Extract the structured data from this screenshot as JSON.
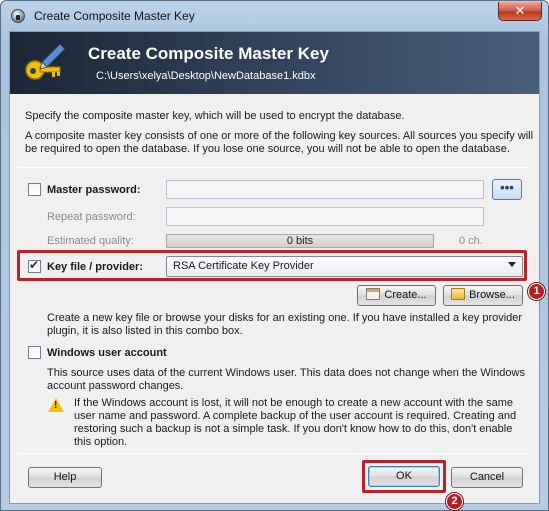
{
  "window": {
    "title": "Create Composite Master Key",
    "close_label": "✕"
  },
  "banner": {
    "title": "Create Composite Master Key",
    "path": "C:\\Users\\xelya\\Desktop\\NewDatabase1.kdbx"
  },
  "intro": {
    "line1": "Specify the composite master key, which will be used to encrypt the database.",
    "line2": "A composite master key consists of one or more of the following key sources. All sources you specify will",
    "line3": "be required to open the database.  If you lose one source, you will not be able to open the database."
  },
  "password": {
    "label": "Master password:",
    "checked": false,
    "repeat_label": "Repeat password:",
    "quality_label": "Estimated quality:",
    "quality_value": "0 bits",
    "quality_chars": "0 ch.",
    "reveal_label": "•••"
  },
  "keyfile": {
    "label": "Key file / provider:",
    "checked": true,
    "selected": "RSA Certificate Key Provider",
    "create_label": "Create...",
    "browse_label": "Browse...",
    "help_line1": "Create a new key file or browse your disks for an existing one. If you have installed a key provider",
    "help_line2": "plugin, it is also listed in this combo box."
  },
  "winuser": {
    "label": "Windows user account",
    "checked": false,
    "desc1": "This source uses data of the current Windows user. This data does not change when the Windows",
    "desc2": "account password changes.",
    "warn1": "If the Windows account is lost, it will not be enough to create a new account with the same",
    "warn2": "user name and password. A complete backup of the user account is required. Creating and",
    "warn3": "restoring such a backup is not a simple task. If you don't know how to do this, don't enable",
    "warn4": "this option."
  },
  "footer": {
    "help_label": "Help",
    "ok_label": "OK",
    "cancel_label": "Cancel"
  },
  "annotations": {
    "badge1": "1",
    "badge2": "2"
  },
  "colors": {
    "highlight": "#b8232a",
    "banner": "#2f4058"
  }
}
